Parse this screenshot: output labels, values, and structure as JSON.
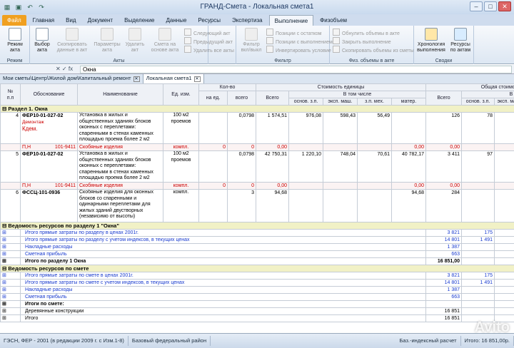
{
  "app": {
    "title": "ГРАНД-Смета - Локальная смета1"
  },
  "tabs": [
    "Файл",
    "Главная",
    "Вид",
    "Документ",
    "Выделение",
    "Данные",
    "Ресурсы",
    "Экспертиза",
    "Выполнение",
    "Физобъем"
  ],
  "ribbon": {
    "mode": {
      "btn": "Режим\nакта",
      "group": "Режим"
    },
    "acts": {
      "group": "Акты",
      "select": "Выбор\nакта",
      "copy": "Скопировать\nданные в акт",
      "params": "Параметры\nакта",
      "delete": "Удалить\nакт",
      "estimate": "Смета на\nоснове акта",
      "next": "Следующий акт",
      "prev": "Предыдущий акт",
      "delete_all": "Удалить все акты"
    },
    "filter": {
      "group": "Фильтр",
      "filter": "Фильтр\nвкл/выкл",
      "rest": "Позиции с остатком",
      "done": "Позиции с выполнением",
      "invert": "Инвертировать условие"
    },
    "phys": {
      "group": "Физ. объемы в акте",
      "zero": "Обнулить объемы в акте",
      "close": "Закрыть выполнение",
      "fill": "Скопировать объемы из сметы"
    },
    "summary": {
      "group": "Сводки",
      "chron": "Хронология\nвыполнения",
      "res": "Ресурсы\nпо актам"
    }
  },
  "formula": {
    "cell": "",
    "value": "Окна"
  },
  "doc_tabs": {
    "path": "Мои сметы\\Центр\\Жилой дом\\Капитальный ремонт",
    "active": "Локальная смета1"
  },
  "grid": {
    "headers": {
      "num": "№\nп.п",
      "basis": "Обоснование",
      "name": "Наименование",
      "unit": "Ед. изм.",
      "qty": "Кол-во",
      "per_unit": "на ед.",
      "total": "всего",
      "unit_cost": "Стоимость единицы",
      "all": "Всего",
      "incl": "В том числе",
      "base_zp": "основ. з.п.",
      "eksp": "эксп. маш.",
      "zp_meh": "з.п. мех.",
      "mater": "матер.",
      "total_cost": "Общая стоимость",
      "all2": "Всего",
      "incl2": "В том",
      "base_zp2": "основ. з.п.",
      "eksp2": "эксп. маш."
    },
    "section1": "Раздел 1. Окна",
    "rows": [
      {
        "n": "4",
        "code": "ФЕР10-01-027-02",
        "note1": "Демонтаж",
        "note2": "Кдем.",
        "desc": "Установка в жилых и общественных зданиях блоков оконных с переплетами: спаренными в стенах каменных площадью проема более 2 м2",
        "unit": "100 м2 проемов",
        "per": "",
        "tot": "0,0798",
        "all": "1 574,51",
        "bzp": "976,08",
        "em": "598,43",
        "zpm": "56,49",
        "mat": "",
        "ctot": "126",
        "cbzp": "78",
        "cem": "48"
      },
      {
        "n": "5",
        "code": "ФЕР10-01-027-02",
        "note1": "",
        "note2": "",
        "desc": "Установка в жилых и общественных зданиях блоков оконных с переплетами: спаренными в стенах каменных площадью проема более 2 м2",
        "unit": "100 м2 проемов",
        "per": "",
        "tot": "0,0798",
        "all": "42 750,31",
        "bzp": "1 220,10",
        "em": "748,04",
        "zpm": "70,61",
        "mat": "40 782,17",
        "ctot": "3 411",
        "cbzp": "97",
        "cem": "60"
      },
      {
        "n": "6",
        "code": "ФССЦ-101-0936",
        "note1": "",
        "note2": "",
        "desc": "Скобяные изделия для оконных блоков со спаренными и одинарными переплетами для жилых зданий двустворных (независимо от высоты)",
        "unit": "компл.",
        "per": "",
        "tot": "3",
        "all": "94,68",
        "bzp": "",
        "em": "",
        "zpm": "",
        "mat": "94,68",
        "ctot": "284",
        "cbzp": "",
        "cem": ""
      }
    ],
    "subrow": {
      "code": "П,Н",
      "ref": "101-9411",
      "name": "Скобяные изделия",
      "unit": "компл.",
      "per": "0",
      "tot": "0",
      "all": "0,00",
      "mat": "0,00",
      "ctot": "0,00"
    },
    "section2": "Ведомость ресурсов по разделу 1 \"Окна\"",
    "sec2_rows": [
      {
        "label": "Итого прямые затраты по разделу в ценах 2001г.",
        "v1": "3 821",
        "v2": "175",
        "v3": "108",
        "cls": "blue"
      },
      {
        "label": "Итого прямые затраты по разделу с учетом индексов, в текущих ценах",
        "v1": "14 801",
        "v2": "1 491",
        "v3": "491",
        "cls": "blue"
      },
      {
        "label": "Накладные расходы",
        "v1": "1 387",
        "v2": "",
        "v3": "",
        "cls": "blue"
      },
      {
        "label": "Сметная прибыль",
        "v1": "663",
        "v2": "",
        "v3": "",
        "cls": "blue"
      },
      {
        "label": "Итого по разделу 1 Окна",
        "v1": "16 851,00",
        "v2": "",
        "v3": "",
        "cls": "bold"
      }
    ],
    "section3": "Ведомость ресурсов по смете",
    "sec3_rows": [
      {
        "label": "Итого прямые затраты по смете в ценах 2001г.",
        "v1": "3 821",
        "v2": "175",
        "v3": "108",
        "cls": "blue"
      },
      {
        "label": "Итого прямые затраты по смете с учетом индексов, в текущих ценах",
        "v1": "14 801",
        "v2": "1 491",
        "v3": "491",
        "cls": "blue"
      },
      {
        "label": "Накладные расходы",
        "v1": "1 387",
        "v2": "",
        "v3": "",
        "cls": "blue"
      },
      {
        "label": "Сметная прибыль",
        "v1": "663",
        "v2": "",
        "v3": "",
        "cls": "blue"
      },
      {
        "label": "Итоги по смете:",
        "v1": "",
        "v2": "",
        "v3": "",
        "cls": "bold"
      },
      {
        "label": "Деревянные конструкции",
        "v1": "16 851",
        "v2": "",
        "v3": "",
        "cls": "plain"
      },
      {
        "label": "Итого",
        "v1": "16 851",
        "v2": "",
        "v3": "",
        "cls": "plain"
      }
    ]
  },
  "status": {
    "norm": "ГЭСН, ФЕР - 2001 (в редакции 2009 г. с Изм.1-8)",
    "region": "Базовый федеральный район",
    "calc": "Баз.-индексный расчет",
    "total": "Итого: 16 851,00р."
  },
  "watermark": "Avito"
}
